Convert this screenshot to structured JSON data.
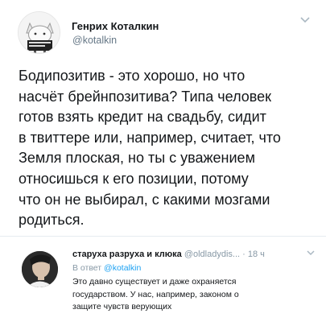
{
  "tweet": {
    "author_name": "Генрих Коталкин",
    "handle": "@kotalkin",
    "text": "Бодипозитив - это хорошо, но что\nнасчёт брейнпозитива? Типа человек\nготов взять кредит на свадьбу, сидит\nв твиттере или, например, считает, что\nЗемля плоская, но ты с уважением\nотносишься к его позиции, потому\nчто он не выбирал, с какими мозгами\nродиться."
  },
  "reply": {
    "author_name": "старуха разруха и клюка",
    "handle": "@oldladydis...",
    "separator": " · ",
    "time": "18 ч",
    "in_reply_prefix": "В ответ ",
    "in_reply_handle": "@kotalkin",
    "text": "Это давно существует и даже охраняется\nгосударством. У нас, например, законом о\nзащите чувств верующих"
  },
  "icons": {
    "tweet_menu": "chevron-down-icon",
    "reply_menu": "chevron-down-icon"
  },
  "colors": {
    "link": "#1da1f2",
    "secondary_text": "#657786",
    "primary_text": "#14171a"
  }
}
